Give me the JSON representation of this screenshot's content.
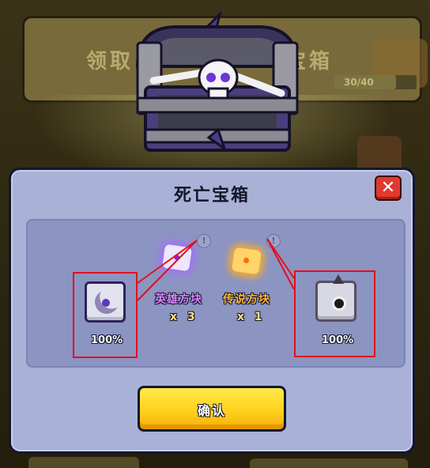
{
  "background": {
    "banner_text_left": "领取",
    "banner_text_right": "宝箱",
    "progress_label": "30/40",
    "progress_fraction": 0.75
  },
  "modal": {
    "title": "死亡宝箱",
    "close_symbol": "✕",
    "confirm_label": "确认"
  },
  "rewards": {
    "left_item": {
      "icon": "scythe-skill-card-icon",
      "percent": "100%"
    },
    "right_item": {
      "icon": "monster-face-card-icon",
      "percent": "100%"
    },
    "hero_cube": {
      "label": "英雄方块",
      "count": "x 3",
      "color": "#d783ff"
    },
    "legend_cube": {
      "label": "传说方块",
      "count": "x 1",
      "color": "#ffb532"
    },
    "info_symbol": "!"
  },
  "colors": {
    "modal_bg": "#aab1d6",
    "panel_bg": "#8c94c2",
    "confirm_yellow": "#ffd21c",
    "close_red": "#e0392e",
    "annotation_red": "#e2101a"
  }
}
